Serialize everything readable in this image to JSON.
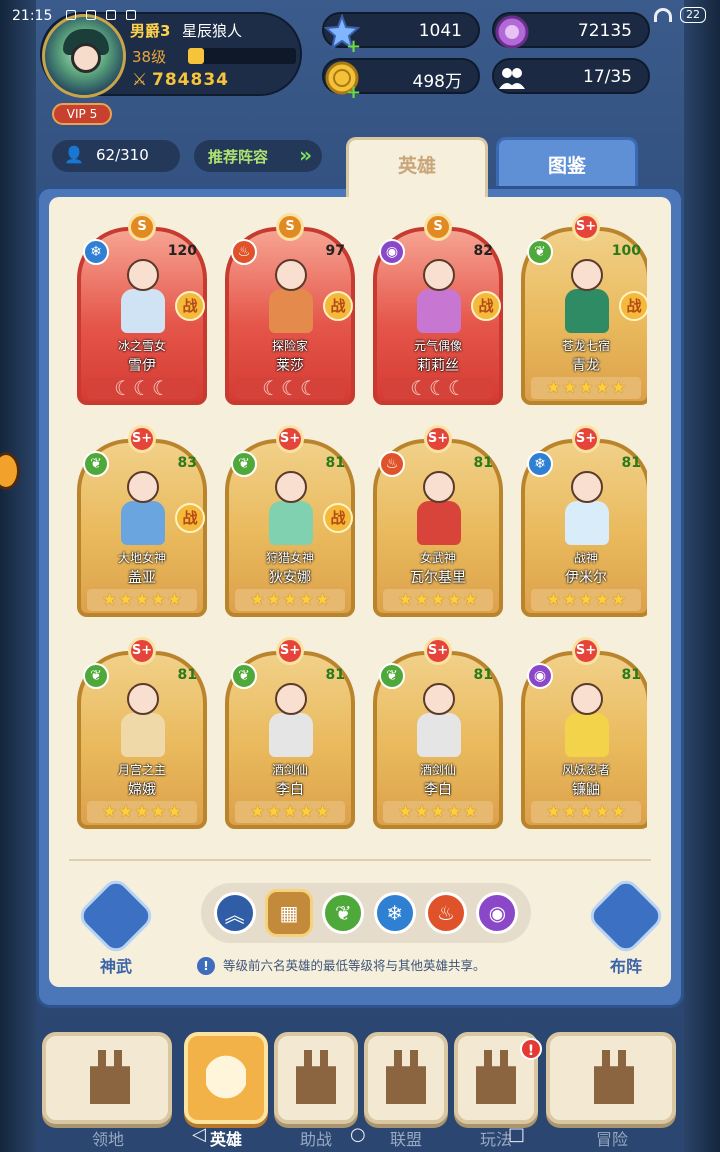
{
  "status_bar": {
    "time": "21:15",
    "battery": "22"
  },
  "profile": {
    "rank": "男爵3",
    "name": "星辰狼人",
    "level": "38级",
    "xp_fraction": 0.15,
    "power": "784834",
    "vip": "VIP 5"
  },
  "currencies": [
    {
      "id": "stars",
      "value": "1041",
      "color": "#7fb6ff"
    },
    {
      "id": "gems",
      "value": "72135",
      "color": "#b26ad8"
    },
    {
      "id": "gold",
      "value": "498万",
      "color": "#f3c23a"
    },
    {
      "id": "friends",
      "value": "17/35",
      "color": "#ffffff"
    }
  ],
  "hero_count": "62/310",
  "recommend_label": "推荐阵容",
  "tabs": {
    "heroes": "英雄",
    "atlas": "图鉴"
  },
  "heroes": [
    {
      "grade": "S",
      "element": "ice",
      "level": "120",
      "title": "冰之雪女",
      "name": "雪伊",
      "style": "red",
      "in_battle": true,
      "foot": "moon",
      "body_color": "#cfe3f5"
    },
    {
      "grade": "S",
      "element": "fire",
      "level": "97",
      "title": "探险家",
      "name": "莱莎",
      "style": "red",
      "in_battle": true,
      "foot": "moon",
      "body_color": "#e58a4d"
    },
    {
      "grade": "S",
      "element": "dark",
      "level": "82",
      "title": "元气偶像",
      "name": "莉莉丝",
      "style": "red",
      "in_battle": true,
      "foot": "moon",
      "body_color": "#c777d2"
    },
    {
      "grade": "S+",
      "element": "wind",
      "level": "100",
      "title": "苍龙七宿",
      "name": "青龙",
      "style": "gold",
      "in_battle": true,
      "foot": "stars",
      "body_color": "#2e8b63"
    },
    {
      "grade": "S+",
      "element": "wind",
      "level": "83",
      "title": "大地女神",
      "name": "盖亚",
      "style": "gold",
      "in_battle": true,
      "foot": "stars",
      "body_color": "#6aa5e0"
    },
    {
      "grade": "S+",
      "element": "wind",
      "level": "81",
      "title": "狩猎女神",
      "name": "狄安娜",
      "style": "gold",
      "in_battle": true,
      "foot": "stars",
      "body_color": "#7fd1b0"
    },
    {
      "grade": "S+",
      "element": "fire",
      "level": "81",
      "title": "女武神",
      "name": "瓦尔基里",
      "style": "gold",
      "in_battle": false,
      "foot": "stars",
      "body_color": "#d8433a"
    },
    {
      "grade": "S+",
      "element": "ice",
      "level": "81",
      "title": "战神",
      "name": "伊米尔",
      "style": "gold",
      "in_battle": false,
      "foot": "stars",
      "body_color": "#d8ecfa"
    },
    {
      "grade": "S+",
      "element": "wind",
      "level": "81",
      "title": "月宫之主",
      "name": "嫦娥",
      "style": "gold",
      "in_battle": false,
      "foot": "stars",
      "body_color": "#f0d9a8"
    },
    {
      "grade": "S+",
      "element": "wind",
      "level": "81",
      "title": "酒剑仙",
      "name": "李白",
      "style": "gold",
      "in_battle": false,
      "foot": "stars",
      "body_color": "#e5e5e5"
    },
    {
      "grade": "S+",
      "element": "wind",
      "level": "81",
      "title": "酒剑仙",
      "name": "李白",
      "style": "gold",
      "in_battle": false,
      "foot": "stars",
      "body_color": "#e5e5e5"
    },
    {
      "grade": "S+",
      "element": "dark",
      "level": "81",
      "title": "风妖忍者",
      "name": "镰鼬",
      "style": "gold",
      "in_battle": false,
      "foot": "stars",
      "body_color": "#f2d34a"
    }
  ],
  "battle_label": "战",
  "shenwu_label": "神武",
  "buzhen_label": "布阵",
  "filter_icons": [
    "up-arrows",
    "all-grid",
    "wind",
    "ice",
    "fire",
    "dark"
  ],
  "element_colors": {
    "ice": "#2f7fd3",
    "fire": "#e0532a",
    "dark": "#8a48c8",
    "wind": "#4fa83a"
  },
  "note": "等级前六名英雄的最低等级将与其他英雄共享。",
  "nav": [
    {
      "id": "territory",
      "label": "领地"
    },
    {
      "id": "heroes",
      "label": "英雄",
      "active": true
    },
    {
      "id": "battle",
      "label": "助战"
    },
    {
      "id": "alliance",
      "label": "联盟"
    },
    {
      "id": "play",
      "label": "玩法",
      "alert": "!"
    },
    {
      "id": "adventure",
      "label": "冒险"
    }
  ]
}
